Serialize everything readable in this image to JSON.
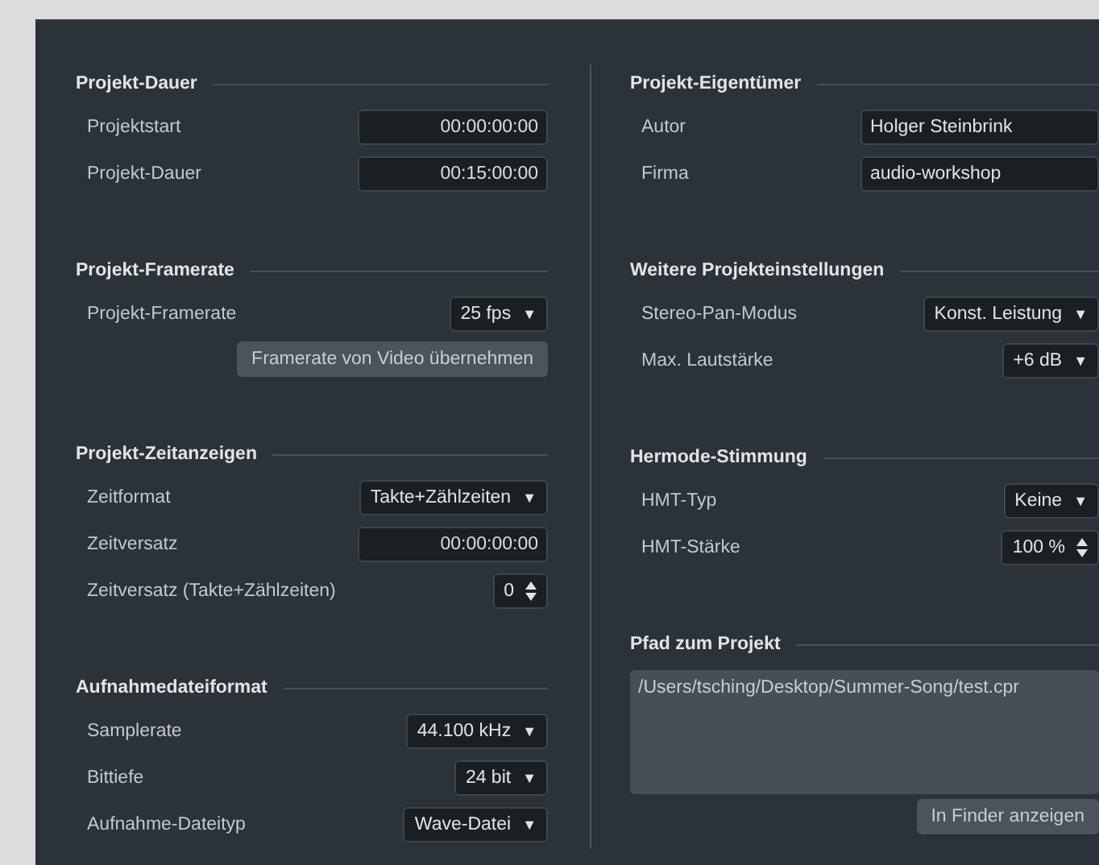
{
  "columns": [
    {
      "sections": [
        {
          "title": "Projekt-Dauer",
          "rows": [
            {
              "kind": "time",
              "label": "Projektstart",
              "value": "00:00:00:00"
            },
            {
              "kind": "time",
              "label": "Projekt-Dauer",
              "value": "00:15:00:00"
            }
          ]
        },
        {
          "title": "Projekt-Framerate",
          "rows": [
            {
              "kind": "select",
              "label": "Projekt-Framerate",
              "value": "25 fps",
              "arrow": "▼"
            },
            {
              "kind": "button",
              "value": "Framerate von Video übernehmen"
            }
          ]
        },
        {
          "title": "Projekt-Zeitanzeigen",
          "rows": [
            {
              "kind": "select",
              "label": "Zeitformat",
              "value": "Takte+Zählzeiten",
              "arrow": "▼"
            },
            {
              "kind": "time",
              "label": "Zeitversatz",
              "value": "00:00:00:00"
            },
            {
              "kind": "spin",
              "label": "Zeitversatz (Takte+Zählzeiten)",
              "value": "0"
            }
          ]
        },
        {
          "title": "Aufnahmedateiformat",
          "rows": [
            {
              "kind": "select",
              "label": "Samplerate",
              "value": "44.100 kHz",
              "arrow": "▼"
            },
            {
              "kind": "select",
              "label": "Bittiefe",
              "value": "24 bit",
              "arrow": "▼"
            },
            {
              "kind": "select",
              "label": "Aufnahme-Dateityp",
              "value": "Wave-Datei",
              "arrow": "▼"
            }
          ]
        }
      ]
    },
    {
      "sections": [
        {
          "title": "Projekt-Eigentümer",
          "rows": [
            {
              "kind": "text",
              "label": "Autor",
              "value": "Holger Steinbrink"
            },
            {
              "kind": "text",
              "label": "Firma",
              "value": "audio-workshop"
            }
          ]
        },
        {
          "title": "Weitere Projekteinstellungen",
          "rows": [
            {
              "kind": "select",
              "label": "Stereo-Pan-Modus",
              "value": "Konst. Leistung",
              "arrow": "▼"
            },
            {
              "kind": "select",
              "label": "Max. Lautstärke",
              "value": "+6 dB",
              "arrow": "▼"
            }
          ]
        },
        {
          "title": "Hermode-Stimmung",
          "rows": [
            {
              "kind": "select",
              "label": "HMT-Typ",
              "value": "Keine",
              "arrow": "▼"
            },
            {
              "kind": "spin",
              "label": "HMT-Stärke",
              "value": "100 %"
            }
          ]
        },
        {
          "title": "Pfad zum Projekt",
          "rows": [
            {
              "kind": "path",
              "value": "/Users/tsching/Desktop/Summer-Song/test.cpr"
            },
            {
              "kind": "button",
              "value": "In Finder anzeigen"
            }
          ]
        }
      ]
    }
  ]
}
